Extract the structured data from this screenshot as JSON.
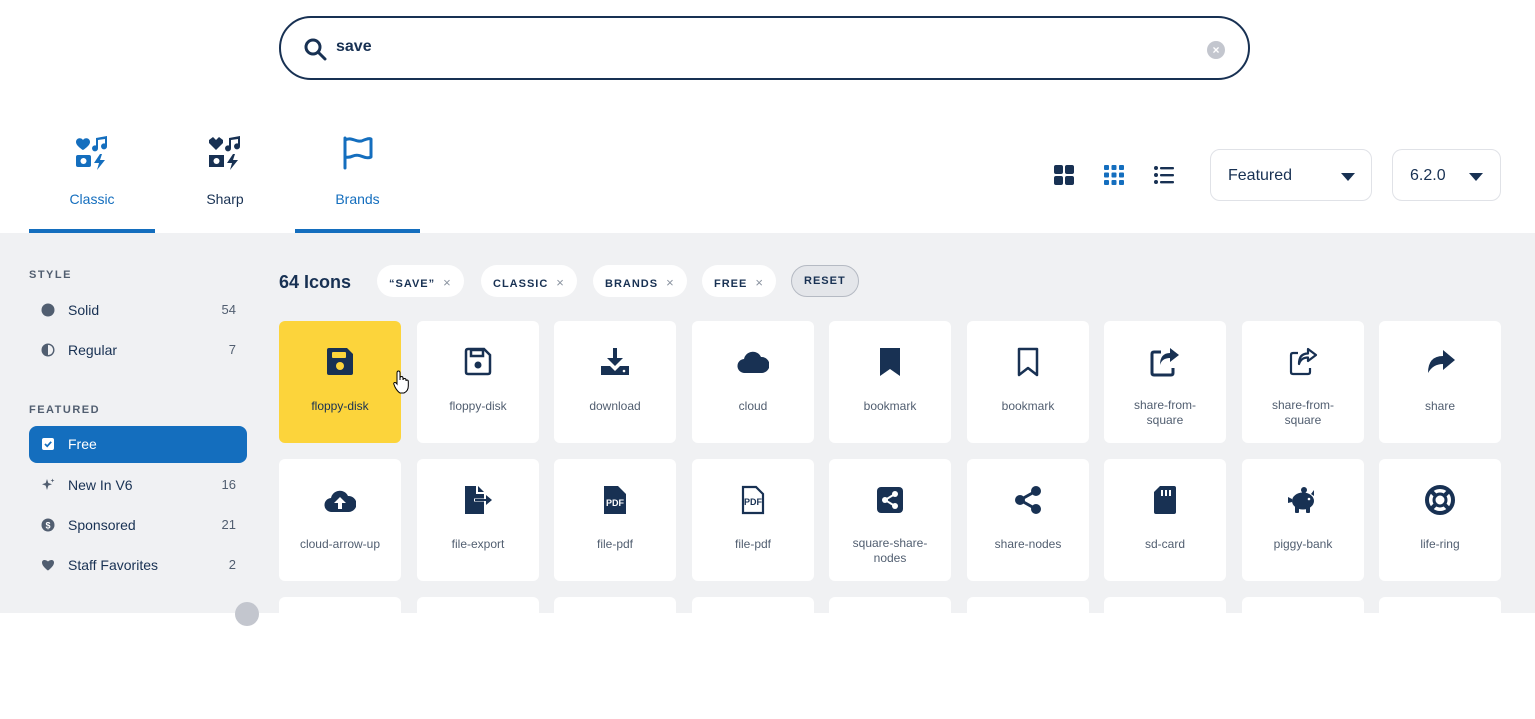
{
  "search": {
    "value": "save"
  },
  "tabs": [
    {
      "label": "Classic"
    },
    {
      "label": "Sharp"
    },
    {
      "label": "Brands"
    }
  ],
  "view_buttons": [
    "large-grid-icon",
    "small-grid-icon",
    "list-icon"
  ],
  "sort": {
    "selected": "Featured"
  },
  "version": {
    "selected": "6.2.0"
  },
  "sidebar": {
    "style_header": "STYLE",
    "style_items": [
      {
        "label": "Solid",
        "count": "54",
        "icon": "solid-circle-icon"
      },
      {
        "label": "Regular",
        "count": "7",
        "icon": "half-circle-icon"
      }
    ],
    "featured_header": "FEATURED",
    "featured_items": [
      {
        "label": "Free",
        "count": "",
        "icon": "check-square-icon",
        "selected": true
      },
      {
        "label": "New In V6",
        "count": "16",
        "icon": "sparkles-icon"
      },
      {
        "label": "Sponsored",
        "count": "21",
        "icon": "dollar-circle-icon"
      },
      {
        "label": "Staff Favorites",
        "count": "2",
        "icon": "heart-icon"
      }
    ]
  },
  "results": {
    "count_label": "64 Icons",
    "filters": [
      "“SAVE”",
      "CLASSIC",
      "BRANDS",
      "FREE"
    ],
    "reset_label": "RESET",
    "x_glyph": "×"
  },
  "icons": [
    {
      "name": "floppy-disk"
    },
    {
      "name": "floppy-disk"
    },
    {
      "name": "download"
    },
    {
      "name": "cloud"
    },
    {
      "name": "bookmark"
    },
    {
      "name": "bookmark"
    },
    {
      "name": "share-from-square",
      "line1": "share-from-",
      "line2": "square"
    },
    {
      "name": "share-from-square",
      "line1": "share-from-",
      "line2": "square"
    },
    {
      "name": "share"
    },
    {
      "name": "cloud-arrow-up"
    },
    {
      "name": "file-export"
    },
    {
      "name": "file-pdf"
    },
    {
      "name": "file-pdf"
    },
    {
      "name": "square-share-nodes",
      "line1": "square-share-",
      "line2": "nodes"
    },
    {
      "name": "share-nodes"
    },
    {
      "name": "sd-card"
    },
    {
      "name": "piggy-bank"
    },
    {
      "name": "life-ring"
    }
  ],
  "colors": {
    "accent": "#146ebe",
    "navy": "#183153",
    "selected_card": "#fcd43b",
    "panel_bg": "#f0f1f3"
  }
}
